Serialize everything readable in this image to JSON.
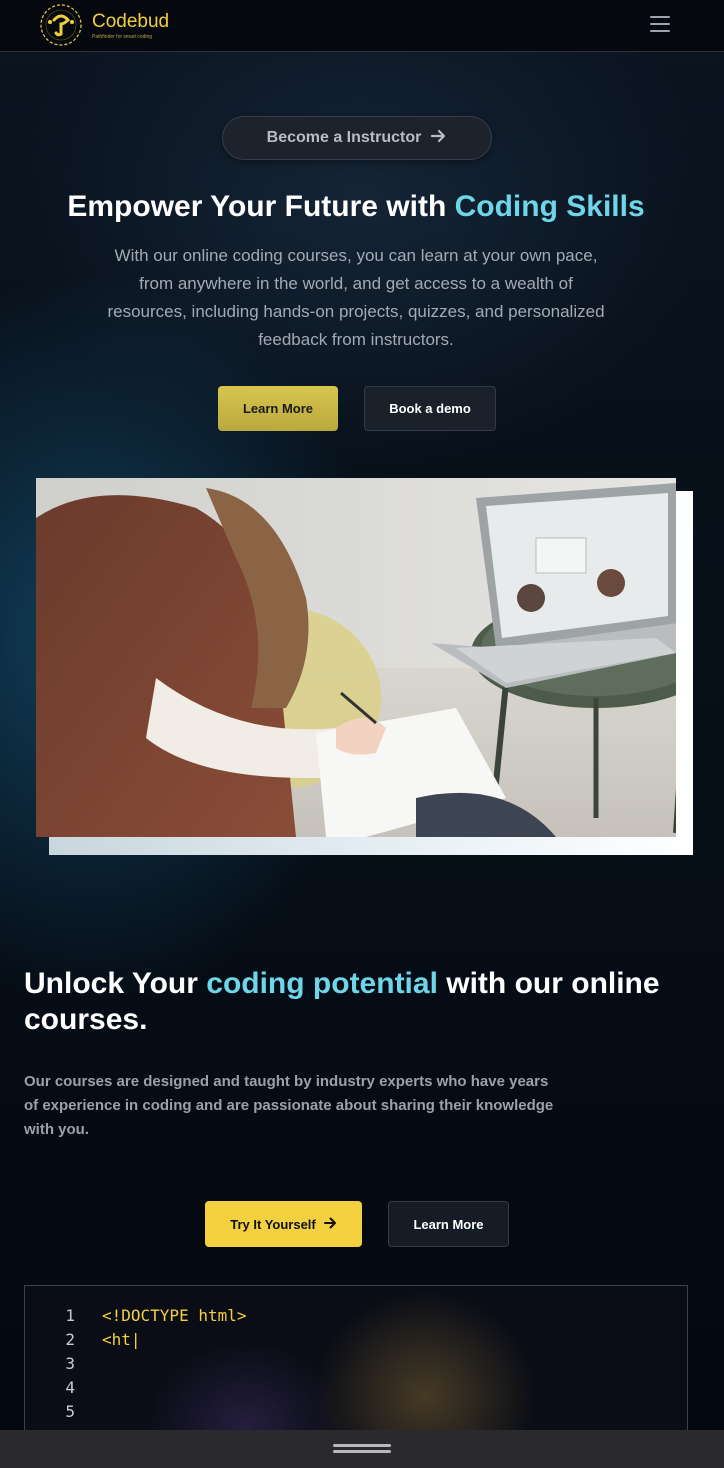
{
  "brand": {
    "name": "Codebud",
    "tagline": "Pathfinder for smart coding",
    "ring_text": "Codebud Codebud",
    "color": "#f2cf3a"
  },
  "nav": {
    "menu_icon": "hamburger-menu-icon"
  },
  "hero": {
    "pill_label": "Become a Instructor",
    "title_prefix": "Empower Your Future with ",
    "title_accent": "Coding Skills",
    "description": "With our online coding courses, you can learn at your own pace, from anywhere in the world, and get access to a wealth of resources, including hands-on projects, quizzes, and personalized feedback from instructors.",
    "primary_button": "Learn More",
    "secondary_button": "Book a demo"
  },
  "section2": {
    "title_prefix": "Unlock Your ",
    "title_accent": "coding potential",
    "title_suffix": " with our online courses.",
    "description": "Our courses are designed and taught by industry experts who have years of experience in coding and are passionate about sharing their knowledge with you.",
    "try_button": "Try It Yourself",
    "learn_button": "Learn More"
  },
  "editor": {
    "lines": [
      {
        "num": "1",
        "code": "<!DOCTYPE html>"
      },
      {
        "num": "2",
        "code": "<ht|"
      },
      {
        "num": "3",
        "code": ""
      },
      {
        "num": "4",
        "code": ""
      },
      {
        "num": "5",
        "code": ""
      }
    ]
  },
  "colors": {
    "accent_cyan": "#6ed6e8",
    "accent_yellow": "#f2d040",
    "background": "#050a14"
  }
}
